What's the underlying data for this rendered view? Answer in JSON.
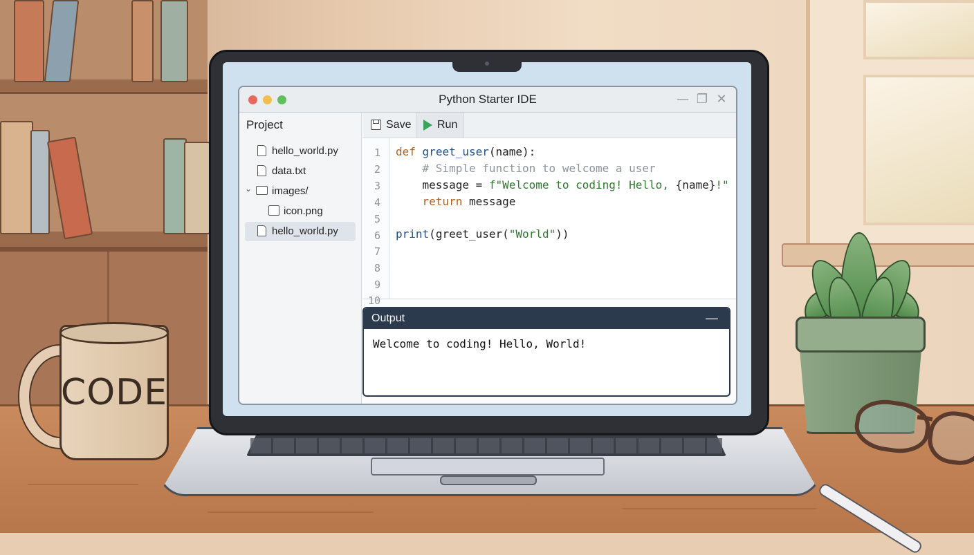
{
  "decor": {
    "mug_text": "CODE"
  },
  "ide": {
    "window_title": "Python Starter IDE",
    "window_controls": {
      "minimize_icon": "minimize-icon",
      "restore_icon": "restore-icon",
      "close_icon": "close-icon"
    },
    "traffic_lights": [
      "#e9685e",
      "#f1be4f",
      "#5fbf5d"
    ],
    "sidebar": {
      "heading": "Project",
      "items": [
        {
          "label": "hello_world.py",
          "type": "file",
          "indent": 0,
          "selected": false
        },
        {
          "label": "data.txt",
          "type": "file",
          "indent": 0,
          "selected": false
        },
        {
          "label": "images/",
          "type": "folder",
          "indent": 0,
          "expanded": true,
          "selected": false
        },
        {
          "label": "icon.png",
          "type": "image",
          "indent": 1,
          "selected": false
        },
        {
          "label": "hello_world.py",
          "type": "file",
          "indent": 0,
          "selected": true
        }
      ]
    },
    "toolbar": {
      "save_label": "Save",
      "run_label": "Run"
    },
    "editor": {
      "line_numbers": [
        "1",
        "2",
        "3",
        "4",
        "5",
        "6",
        "7",
        "8",
        "9",
        "10"
      ],
      "lines": {
        "l1_kw": "def",
        "l1_fn": "greet_user",
        "l1_rest": "(name):",
        "l2_comment": "    # Simple function to welcome a user",
        "l3_pre": "    message = ",
        "l3_str": "f\"Welcome to coding! Hello, ",
        "l3_mid": "{name}",
        "l3_str_end": "!\"",
        "l4_kw": "    return",
        "l4_rest": " message",
        "l6_fn": "print",
        "l6_a": "(",
        "l6_fn2": "greet_user",
        "l6_b": "(",
        "l6_str": "\"World\"",
        "l6_c": "))"
      }
    },
    "output": {
      "title": "Output",
      "minimize_glyph": "—",
      "text": "Welcome to coding! Hello, World!"
    }
  }
}
